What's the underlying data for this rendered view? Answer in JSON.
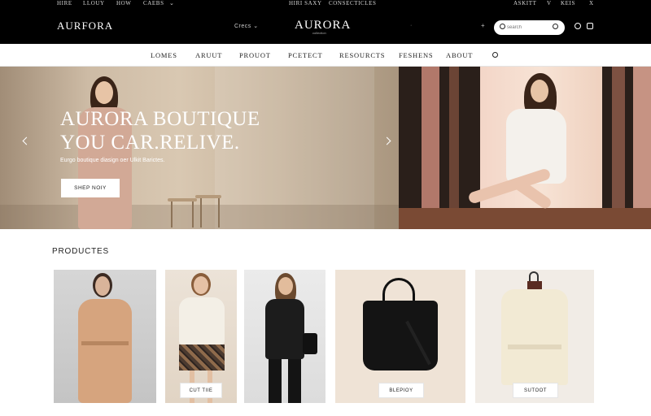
{
  "utility_bar": {
    "left_links": [
      "HIRE",
      "LLOUY",
      "HOW",
      "CAEBS"
    ],
    "center_links": [
      "HIRI SAXY",
      "CONSECTICLES"
    ],
    "right_links": [
      "ASKITT",
      "V",
      "KEIS",
      "X"
    ]
  },
  "header": {
    "brand_left": "AURFORA",
    "currency": "Crecs",
    "brand_center": "AURORA",
    "brand_sub": "collection",
    "lang": "+",
    "search": {
      "placeholder": "search"
    }
  },
  "nav": {
    "items": [
      "LOMES",
      "ARUUT",
      "PROUOT",
      "PCETECT",
      "RESOURCTS",
      "FESHENS",
      "ABOUT"
    ]
  },
  "hero": {
    "title_line1": "AURORA BOUTIQUE",
    "title_line2": "YOU CAR.RELIVE.",
    "subtitle": "Eurgo boutique diasign oer Ulkit Barictes.",
    "button": "SHEP NOIY"
  },
  "products": {
    "section_title": "PRODUCTES",
    "cards": [
      {
        "label": ""
      },
      {
        "label": "CUT TIIE"
      },
      {
        "label": ""
      },
      {
        "label": "BLEPIOY"
      },
      {
        "label": "SUTOOT"
      }
    ]
  },
  "colors": {
    "header_bg": "#000000",
    "page_bg": "#ffffff",
    "accent": "#222222"
  }
}
